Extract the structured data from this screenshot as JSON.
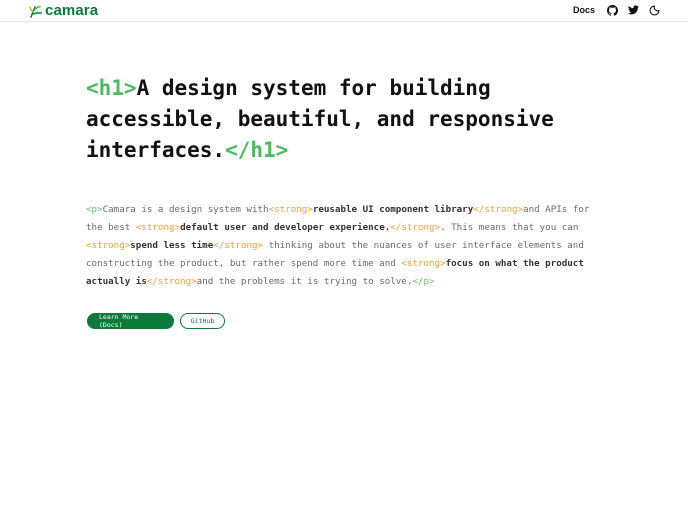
{
  "brand": {
    "name": "camara",
    "color": "#0b7a3b"
  },
  "nav": {
    "docs_label": "Docs",
    "icons": [
      "github-icon",
      "twitter-icon",
      "theme-toggle-icon"
    ]
  },
  "hero": {
    "open_tag": "<h1>",
    "text": "A design system for building accessible, beautiful, and responsive interfaces.",
    "close_tag": "</h1>"
  },
  "intro": {
    "p_open": "<p>",
    "p_close": "</p>",
    "s_open": "<strong>",
    "s_close": "</strong>",
    "t1": "Camara is a design system with",
    "strong1": "reusable UI component library",
    "t2": "and APIs for the best ",
    "strong2": "default user and developer experience.",
    "t3": ". This means that you can ",
    "strong3": "spend less time",
    "t4": " thinking about the nuances of user interface elements and constructing the product, but rather spend more time and ",
    "strong4": "focus on what the product actually is",
    "t5": "and the problems it is trying to solve."
  },
  "buttons": {
    "primary_label": "Learn More (Docs)",
    "secondary_label": "GitHub"
  },
  "colors": {
    "tag_green": "#4cbb5f",
    "strong_tag_orange": "#e8a33a",
    "text_gray": "#6b6b6b"
  }
}
